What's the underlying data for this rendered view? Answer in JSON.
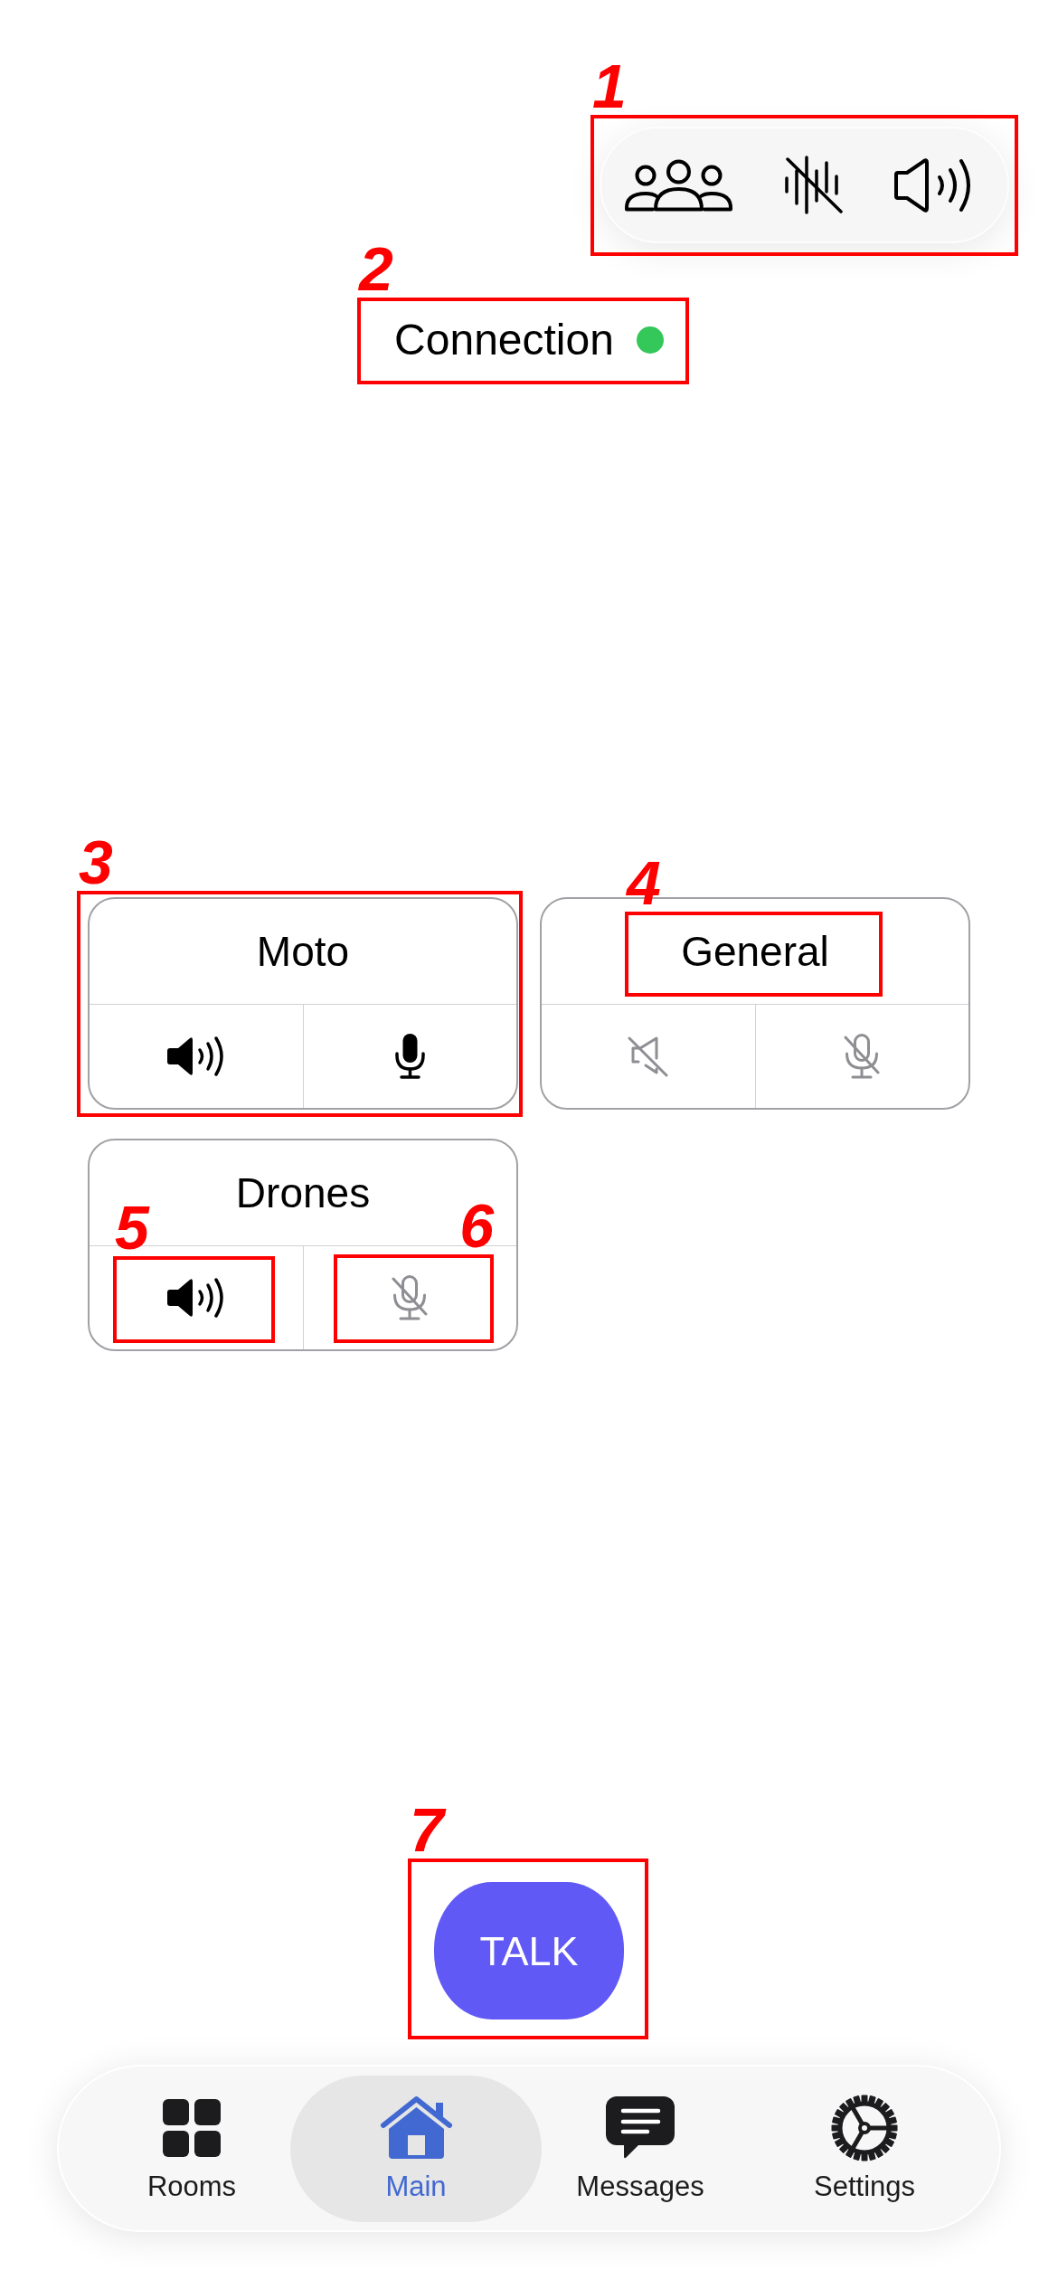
{
  "toolbar": {
    "callout": "1",
    "buttons": [
      {
        "kind": "people"
      },
      {
        "kind": "voice_off"
      },
      {
        "kind": "speaker"
      }
    ]
  },
  "connection": {
    "label": "Connection",
    "connected": true,
    "callout": "2"
  },
  "channels": [
    {
      "name": "Moto",
      "speaker_on": true,
      "mic_on": true,
      "card_callout": "3"
    },
    {
      "name": "General",
      "speaker_on": false,
      "mic_on": false,
      "name_callout": "4"
    },
    {
      "name": "Drones",
      "speaker_on": true,
      "mic_on": false,
      "speaker_callout": "5",
      "mic_callout": "6"
    }
  ],
  "talk_button": {
    "label": "TALK",
    "callout": "7"
  },
  "tab_bar": {
    "items": [
      {
        "label": "Rooms",
        "kind": "rooms",
        "selected": false
      },
      {
        "label": "Main",
        "kind": "home",
        "selected": true
      },
      {
        "label": "Messages",
        "kind": "messages",
        "selected": false
      },
      {
        "label": "Settings",
        "kind": "settings",
        "selected": false
      }
    ]
  }
}
